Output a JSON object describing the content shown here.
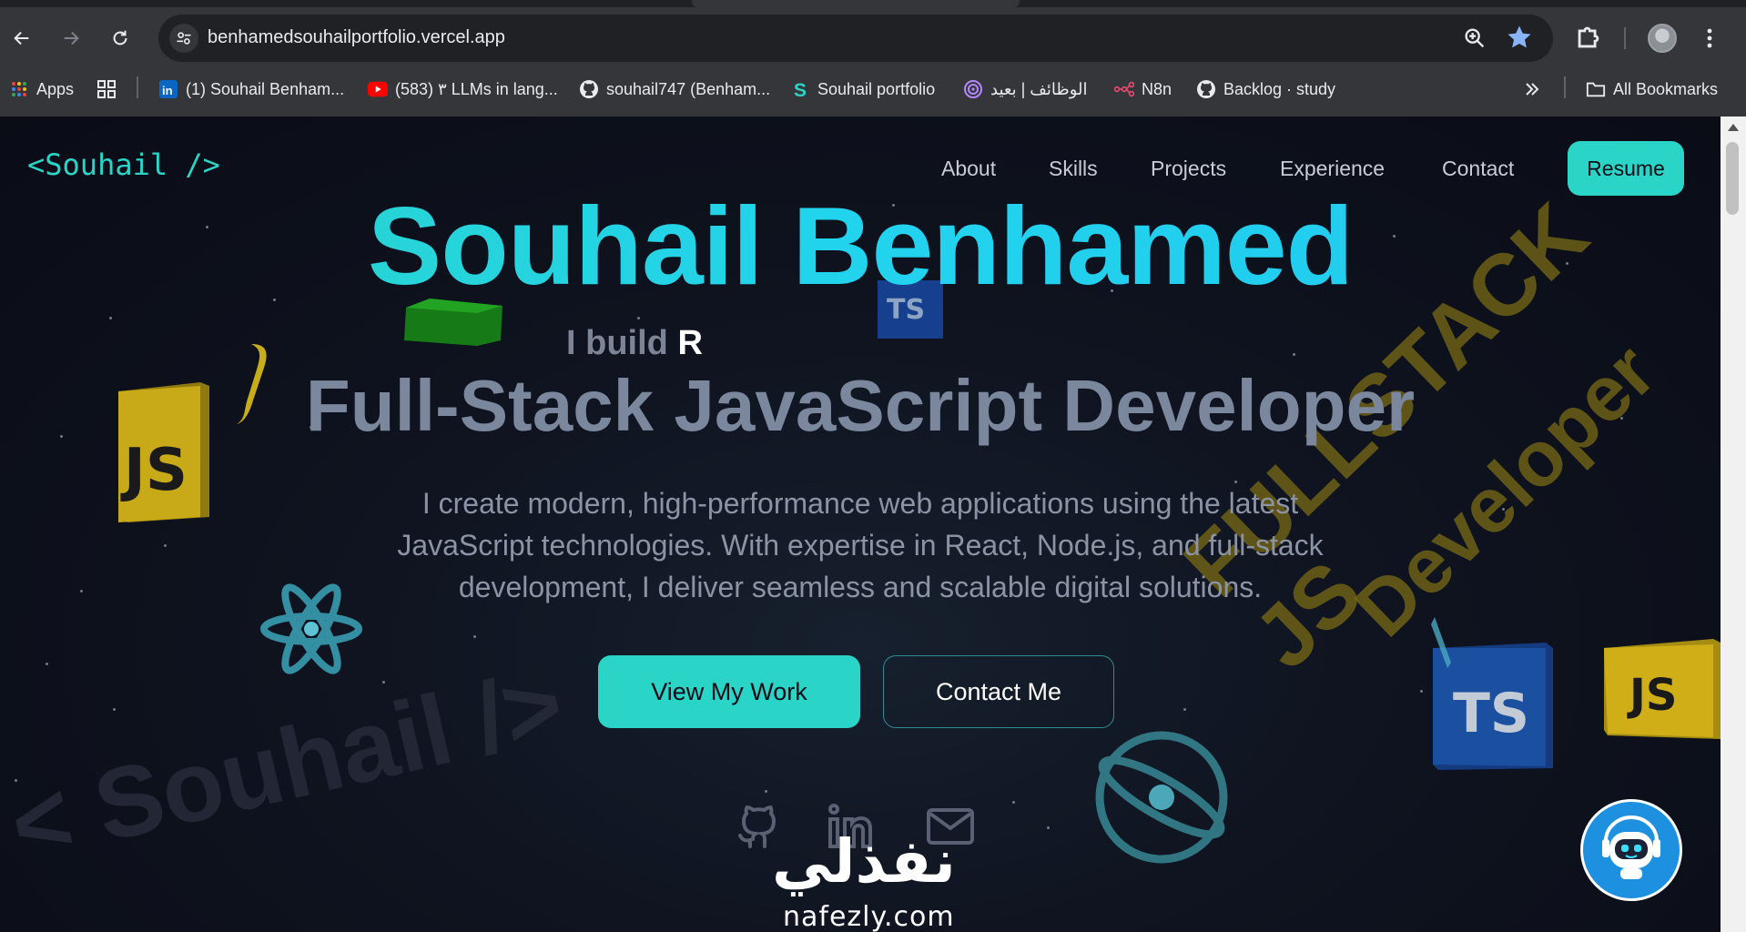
{
  "browser": {
    "url": "benhamedsouhailportfolio.vercel.app",
    "bookmarks": [
      {
        "label": "Apps",
        "icon": "apps-grid-icon"
      },
      {
        "label": "(1) Souhail Benham...",
        "icon": "linkedin-icon"
      },
      {
        "label": "(583) ٣ LLMs in lang...",
        "icon": "youtube-icon"
      },
      {
        "label": "souhail747 (Benham...",
        "icon": "github-icon"
      },
      {
        "label": "Souhail portfolio",
        "icon": "s-logo-icon"
      },
      {
        "label": "الوظائف | بعيد",
        "icon": "radar-icon"
      },
      {
        "label": "N8n",
        "icon": "n8n-icon"
      },
      {
        "label": "Backlog · study",
        "icon": "github-icon"
      },
      {
        "label": "All Bookmarks",
        "icon": "folder-icon"
      }
    ]
  },
  "site": {
    "logo": "<Souhail />",
    "nav": [
      "About",
      "Skills",
      "Projects",
      "Experience",
      "Contact"
    ],
    "resume_label": "Resume",
    "hero": {
      "name": "Souhail Benhamed",
      "typed_prefix": "I build ",
      "typed_text": "R",
      "role": "Full-Stack JavaScript Developer",
      "description": "I create modern, high-performance web applications using the latest JavaScript technologies. With expertise in React, Node.js, and full-stack development, I deliver seamless and scalable digital solutions.",
      "primary_cta": "View My Work",
      "secondary_cta": "Contact Me"
    },
    "decor": {
      "background_watermark": "< Souhail />",
      "fullstack_line1": "FULLSTACK JS",
      "fullstack_line2": "Developer",
      "js_badge": "JS",
      "ts_badge": "TS"
    },
    "watermark": {
      "arabic": "نفذلي",
      "domain": "nafezly.com"
    },
    "colors": {
      "accent": "#2ad4c6",
      "name_gradient_end": "#22d3ee",
      "background": "#0b0d17",
      "js_yellow": "#d4b21a",
      "ts_blue": "#1b4fa0"
    }
  }
}
